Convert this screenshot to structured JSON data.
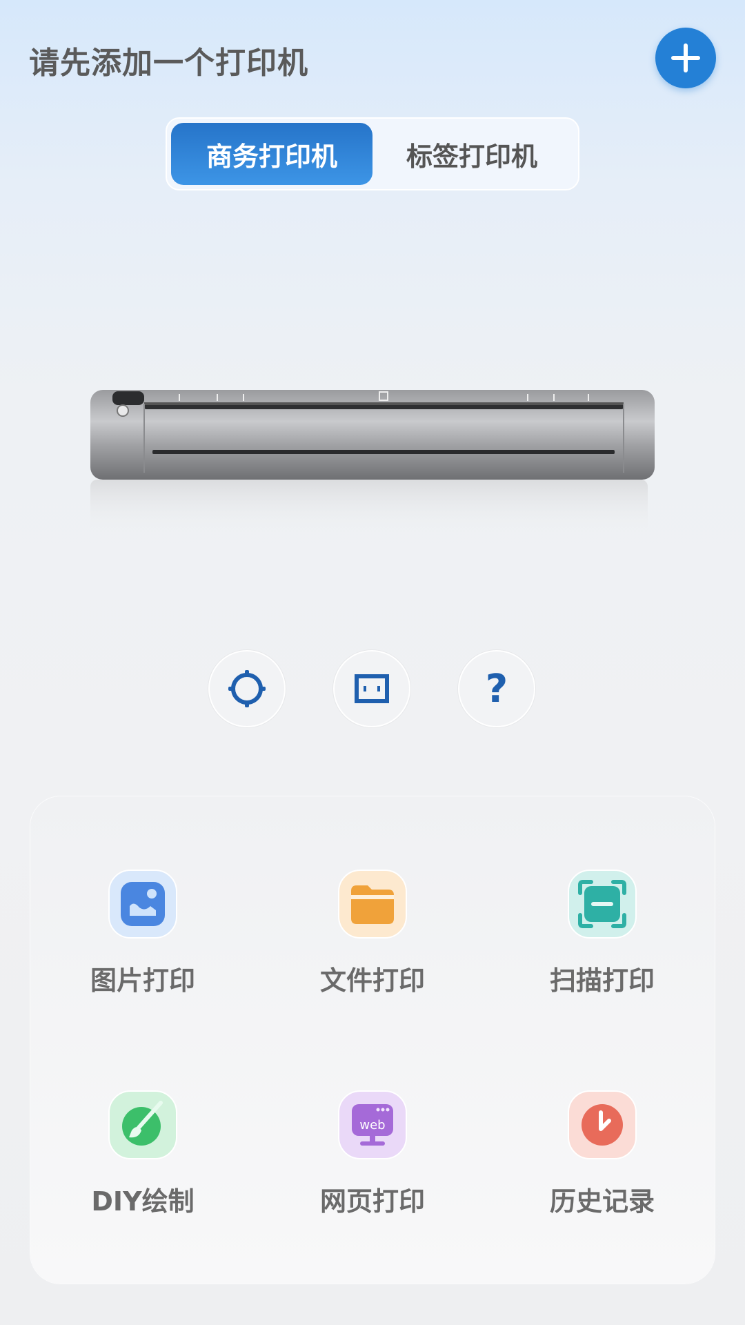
{
  "header": {
    "title": "请先添加一个打印机",
    "add_icon": "plus-icon"
  },
  "tabs": [
    {
      "label": "商务打印机",
      "active": true
    },
    {
      "label": "标签打印机",
      "active": false
    }
  ],
  "printer_controls": [
    {
      "icon": "settings-icon"
    },
    {
      "icon": "paper-size-icon"
    },
    {
      "icon": "help-icon",
      "glyph": "?"
    }
  ],
  "features": [
    {
      "label": "图片打印",
      "icon": "image-icon"
    },
    {
      "label": "文件打印",
      "icon": "folder-icon"
    },
    {
      "label": "扫描打印",
      "icon": "scan-icon"
    },
    {
      "label": "DIY绘制",
      "icon": "paint-brush-icon"
    },
    {
      "label": "网页打印",
      "icon": "web-icon",
      "icon_text": "web"
    },
    {
      "label": "历史记录",
      "icon": "clock-icon"
    }
  ],
  "colors": {
    "accent": "#2480d6",
    "image": "#4a86e0",
    "folder": "#f0a23a",
    "scan": "#2eb0a5",
    "diy": "#3cbf6a",
    "web": "#a56ad8",
    "history": "#e86b5a"
  }
}
